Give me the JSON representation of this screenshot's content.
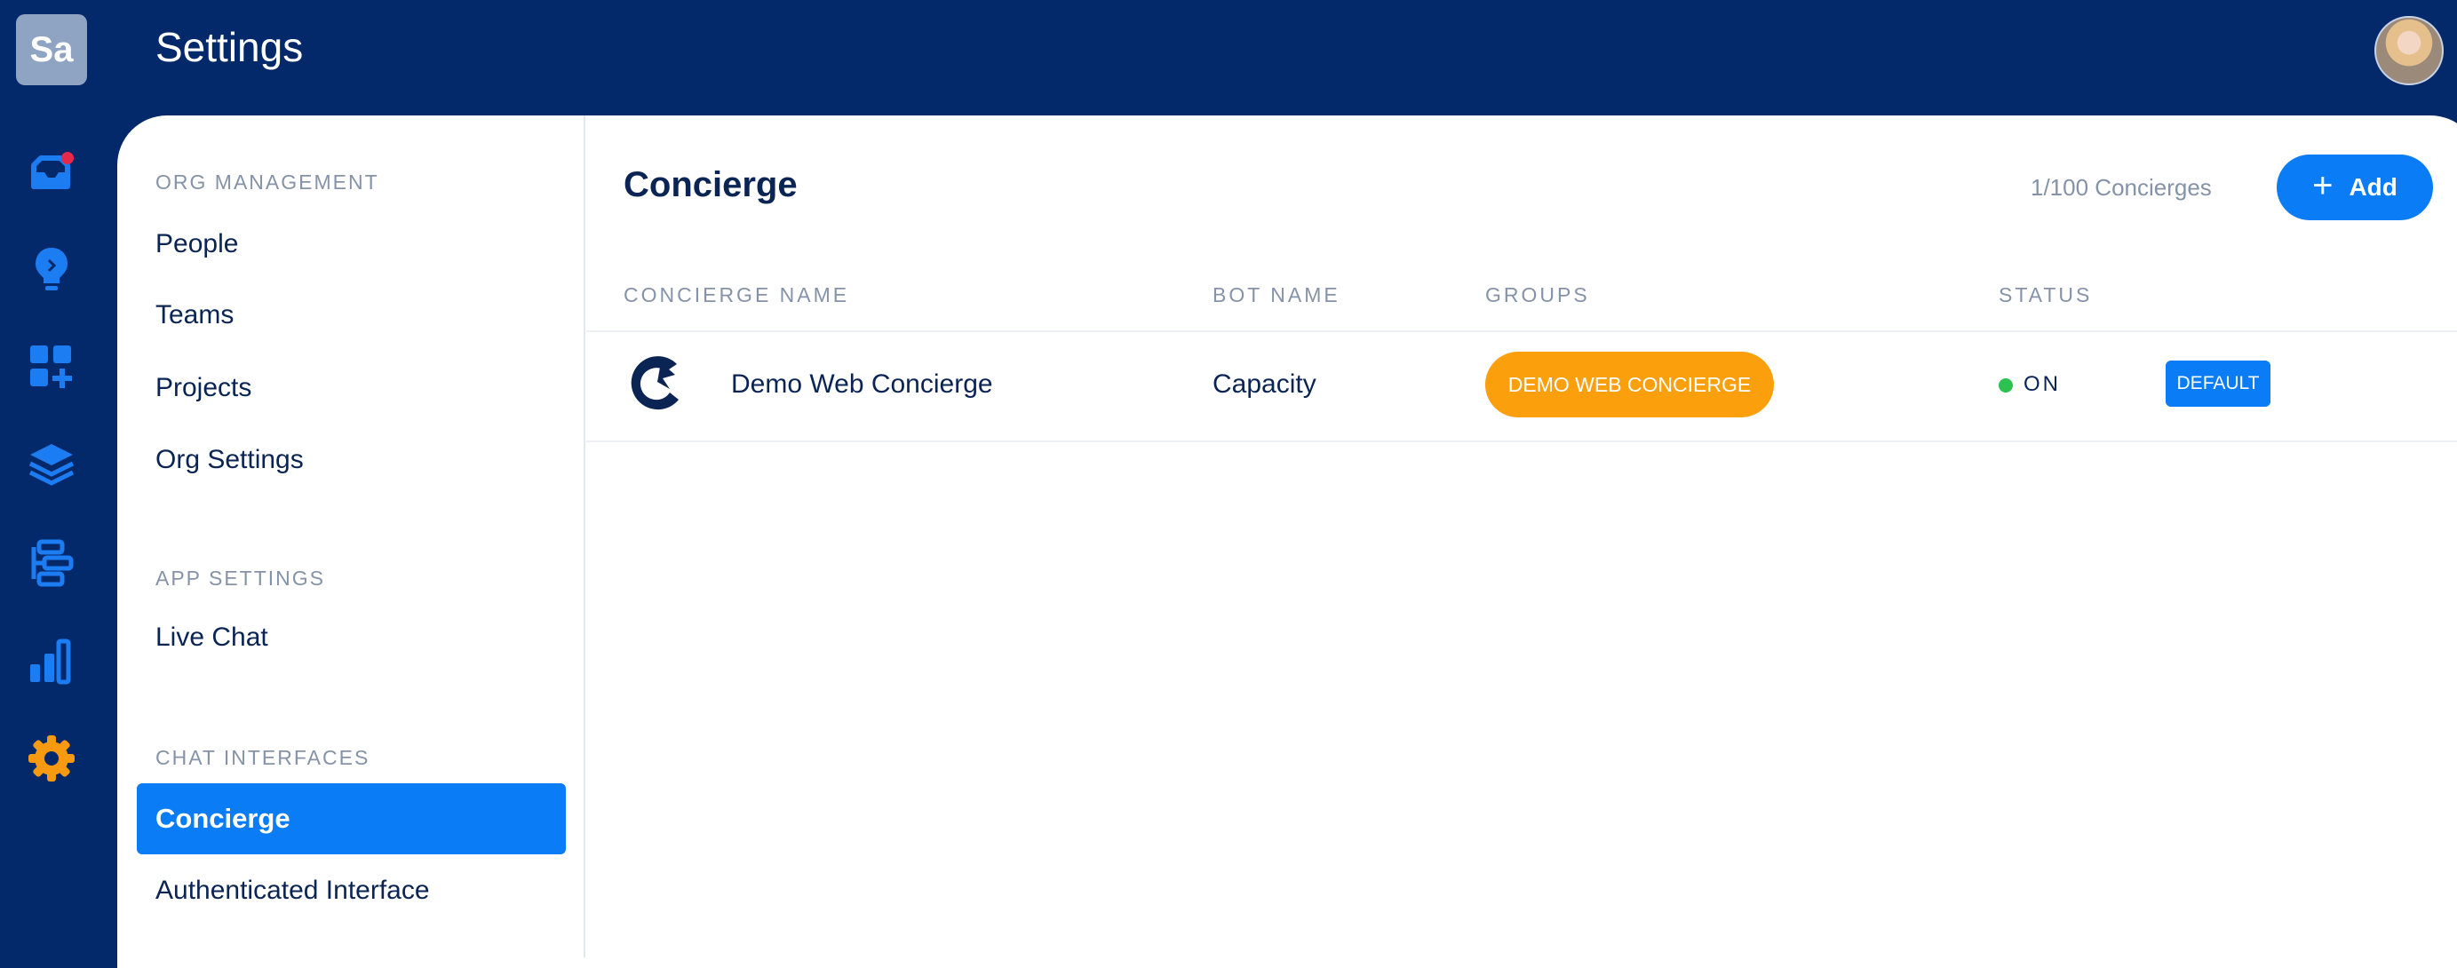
{
  "workspace": {
    "initials": "Sa"
  },
  "header": {
    "title": "Settings"
  },
  "rail": {
    "items": [
      {
        "icon": "inbox-icon",
        "notification": true
      },
      {
        "icon": "lightbulb-icon"
      },
      {
        "icon": "add-apps-icon"
      },
      {
        "icon": "layers-icon"
      },
      {
        "icon": "workflow-icon"
      },
      {
        "icon": "bar-chart-icon"
      },
      {
        "icon": "gear-icon",
        "active": true
      }
    ],
    "colors": {
      "default": "#1c7cf2",
      "active": "#f79a12",
      "notification": "#e5294a"
    }
  },
  "sidebar": {
    "sections": [
      {
        "label": "ORG MANAGEMENT",
        "items": [
          "People",
          "Teams",
          "Projects",
          "Org Settings"
        ]
      },
      {
        "label": "APP SETTINGS",
        "items": [
          "Live Chat"
        ]
      },
      {
        "label": "CHAT INTERFACES",
        "items": [
          "Concierge",
          "Authenticated Interface"
        ]
      }
    ],
    "active_item": "Concierge"
  },
  "main": {
    "title": "Concierge",
    "count_text": "1/100 Concierges",
    "add_label": "Add",
    "columns": [
      "CONCIERGE NAME",
      "BOT NAME",
      "GROUPS",
      "STATUS"
    ],
    "rows": [
      {
        "concierge_name": "Demo Web Concierge",
        "bot_name": "Capacity",
        "group": "DEMO WEB CONCIERGE",
        "status": "ON",
        "badge": "DEFAULT"
      }
    ]
  },
  "colors": {
    "navy": "#03296a",
    "accent_blue": "#0a7cf5",
    "group_orange": "#fb9f0c",
    "status_green": "#2bc250"
  }
}
